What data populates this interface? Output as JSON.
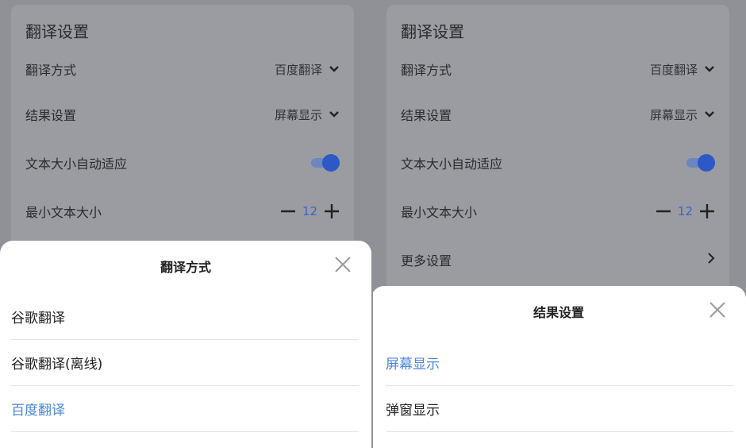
{
  "left": {
    "card": {
      "title": "翻译设置",
      "translate_mode_label": "翻译方式",
      "translate_mode_value": "百度翻译",
      "result_label": "结果设置",
      "result_value": "屏幕显示",
      "autosize_label": "文本大小自动适应",
      "autosize_on": true,
      "min_size_label": "最小文本大小",
      "min_size_value": "12"
    },
    "sheet": {
      "title": "翻译方式",
      "options": [
        "谷歌翻译",
        "谷歌翻译(离线)",
        "百度翻译"
      ],
      "selected": "百度翻译"
    }
  },
  "right": {
    "card": {
      "title": "翻译设置",
      "translate_mode_label": "翻译方式",
      "translate_mode_value": "百度翻译",
      "result_label": "结果设置",
      "result_value": "屏幕显示",
      "autosize_label": "文本大小自动适应",
      "autosize_on": true,
      "min_size_label": "最小文本大小",
      "min_size_value": "12",
      "more_label": "更多设置"
    },
    "sheet": {
      "title": "结果设置",
      "options": [
        "屏幕显示",
        "弹窗显示"
      ],
      "selected": "屏幕显示"
    }
  },
  "colors": {
    "accent": "#2d58c6",
    "selected_option": "#4a86d8",
    "overlay": "#8f9196"
  },
  "icons": {
    "chevron": "chevron-down-icon",
    "close": "close-icon",
    "minus": "minus-icon",
    "plus": "plus-icon",
    "arrow": "chevron-right-icon"
  }
}
